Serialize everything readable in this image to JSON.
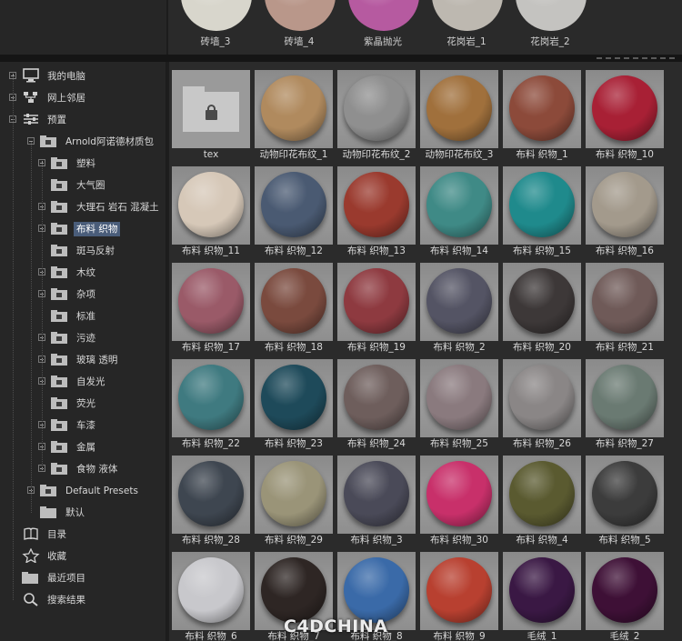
{
  "top_row": {
    "items": [
      {
        "label": "砖墙_3",
        "color": "#d8d6cc"
      },
      {
        "label": "砖墙_4",
        "color": "#b9978a"
      },
      {
        "label": "紫晶抛光",
        "color": "#b65aa0"
      },
      {
        "label": "花岗岩_1",
        "color": "#bdb8b0"
      },
      {
        "label": "花岗岩_2",
        "color": "#c4c3c0"
      }
    ]
  },
  "tree": {
    "items": [
      {
        "label": "我的电脑",
        "icon": "computer-icon",
        "level": 0,
        "expander": "plus"
      },
      {
        "label": "网上邻居",
        "icon": "network-icon",
        "level": 0,
        "expander": "plus"
      },
      {
        "label": "预置",
        "icon": "presets-icon",
        "level": 0,
        "expander": "minus"
      },
      {
        "label": "Arnold阿诺德材质包",
        "icon": "locked-folder-icon",
        "level": 1,
        "expander": "minus"
      },
      {
        "label": "塑料",
        "icon": "locked-folder-icon",
        "level": 2,
        "expander": "plus"
      },
      {
        "label": "大气圈",
        "icon": "locked-folder-icon",
        "level": 2,
        "expander": "none"
      },
      {
        "label": "大理石 岩石 混凝土",
        "icon": "locked-folder-icon",
        "level": 2,
        "expander": "plus"
      },
      {
        "label": "布料 织物",
        "icon": "locked-folder-icon",
        "level": 2,
        "expander": "plus",
        "selected": true
      },
      {
        "label": "斑马反射",
        "icon": "locked-folder-icon",
        "level": 2,
        "expander": "none"
      },
      {
        "label": "木纹",
        "icon": "locked-folder-icon",
        "level": 2,
        "expander": "plus"
      },
      {
        "label": "杂项",
        "icon": "locked-folder-icon",
        "level": 2,
        "expander": "plus"
      },
      {
        "label": "标准",
        "icon": "locked-folder-icon",
        "level": 2,
        "expander": "none"
      },
      {
        "label": "污迹",
        "icon": "locked-folder-icon",
        "level": 2,
        "expander": "plus"
      },
      {
        "label": "玻璃 透明",
        "icon": "locked-folder-icon",
        "level": 2,
        "expander": "plus"
      },
      {
        "label": "自发光",
        "icon": "locked-folder-icon",
        "level": 2,
        "expander": "plus"
      },
      {
        "label": "荧光",
        "icon": "locked-folder-icon",
        "level": 2,
        "expander": "none"
      },
      {
        "label": "车漆",
        "icon": "locked-folder-icon",
        "level": 2,
        "expander": "plus"
      },
      {
        "label": "金属",
        "icon": "locked-folder-icon",
        "level": 2,
        "expander": "plus"
      },
      {
        "label": "食物 液体",
        "icon": "locked-folder-icon",
        "level": 2,
        "expander": "plus"
      },
      {
        "label": "Default Presets",
        "icon": "locked-folder-icon",
        "level": 1,
        "expander": "plus"
      },
      {
        "label": "默认",
        "icon": "folder-icon",
        "level": 1,
        "expander": "none"
      },
      {
        "label": "目录",
        "icon": "catalog-icon",
        "level": 0,
        "expander": "none"
      },
      {
        "label": "收藏",
        "icon": "star-icon",
        "level": 0,
        "expander": "none"
      },
      {
        "label": "最近项目",
        "icon": "folder-icon",
        "level": 0,
        "expander": "none"
      },
      {
        "label": "搜索结果",
        "icon": "search-icon",
        "level": 0,
        "expander": "none"
      }
    ]
  },
  "materials": [
    {
      "label": "tex",
      "kind": "folder"
    },
    {
      "label": "动物印花布纹_1",
      "color": "#b08a5e"
    },
    {
      "label": "动物印花布纹_2",
      "color": "#8f8f8f"
    },
    {
      "label": "动物印花布纹_3",
      "color": "#a0703c"
    },
    {
      "label": "布料 织物_1",
      "color": "#8c4a3a"
    },
    {
      "label": "布料 织物_10",
      "color": "#a82035"
    },
    {
      "label": "布料 织物_11",
      "color": "#d6c8b8"
    },
    {
      "label": "布料 织物_12",
      "color": "#4a5a72"
    },
    {
      "label": "布料 织物_13",
      "color": "#9a3a2e"
    },
    {
      "label": "布料 织物_14",
      "color": "#3f8a86"
    },
    {
      "label": "布料 织物_15",
      "color": "#1f8a8c"
    },
    {
      "label": "布料 织物_16",
      "color": "#a39a8c"
    },
    {
      "label": "布料 织物_17",
      "color": "#9a5a68"
    },
    {
      "label": "布料 织物_18",
      "color": "#7a4a3e"
    },
    {
      "label": "布料 织物_19",
      "color": "#8e3a40"
    },
    {
      "label": "布料 织物_2",
      "color": "#545464"
    },
    {
      "label": "布料 织物_20",
      "color": "#3d3838"
    },
    {
      "label": "布料 织物_21",
      "color": "#6f5a58"
    },
    {
      "label": "布料 织物_22",
      "color": "#3f7a80"
    },
    {
      "label": "布料 织物_23",
      "color": "#1e4a5a"
    },
    {
      "label": "布料 织物_24",
      "color": "#6e5e5c"
    },
    {
      "label": "布料 织物_25",
      "color": "#8a7a7e"
    },
    {
      "label": "布料 织物_26",
      "color": "#8a8686"
    },
    {
      "label": "布料 织物_27",
      "color": "#6a7a72"
    },
    {
      "label": "布料 织物_28",
      "color": "#3e4650"
    },
    {
      "label": "布料 织物_29",
      "color": "#9a9478"
    },
    {
      "label": "布料 织物_3",
      "color": "#4a4a58"
    },
    {
      "label": "布料 织物_30",
      "color": "#c8306a"
    },
    {
      "label": "布料 织物_4",
      "color": "#5a5a30"
    },
    {
      "label": "布料 织物_5",
      "color": "#3c3c3c"
    },
    {
      "label": "布料 织物_6",
      "color": "#c8c8cc"
    },
    {
      "label": "布料 织物_7",
      "color": "#2e2624"
    },
    {
      "label": "布料 织物_8",
      "color": "#3a6aa8"
    },
    {
      "label": "布料 织物_9",
      "color": "#b84030"
    },
    {
      "label": "毛绒_1",
      "color": "#3a1844"
    },
    {
      "label": "毛绒_2",
      "color": "#3e1036"
    }
  ],
  "watermark": "C4DCHINA"
}
